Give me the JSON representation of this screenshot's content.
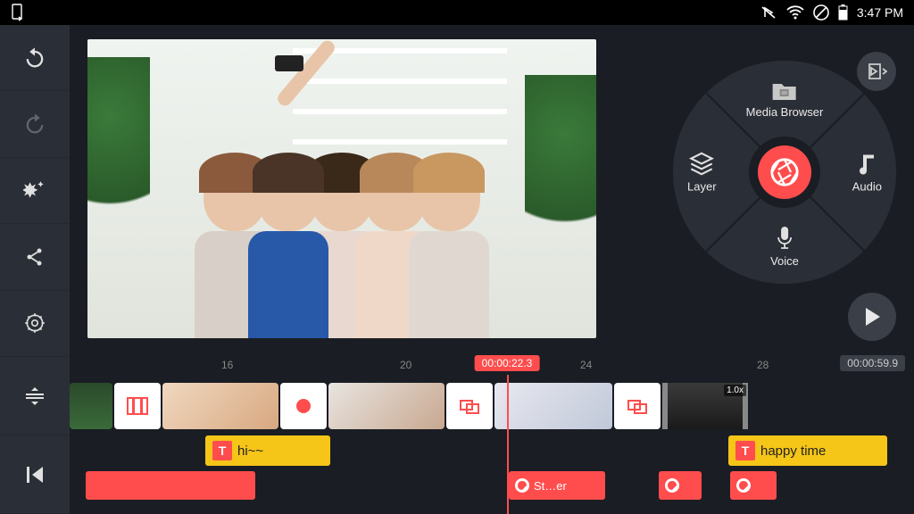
{
  "status": {
    "time": "3:47 PM"
  },
  "wheel": {
    "media_label": "Media Browser",
    "layer_label": "Layer",
    "audio_label": "Audio",
    "voice_label": "Voice"
  },
  "timeline": {
    "current_time": "00:00:22.3",
    "total_time": "00:00:59.9",
    "ticks": [
      "16",
      "20",
      "24",
      "28"
    ],
    "text_clips": [
      {
        "label": "hi~~"
      },
      {
        "label": "happy time"
      }
    ],
    "sticker_label": "St…er",
    "speed": "1.0x"
  }
}
